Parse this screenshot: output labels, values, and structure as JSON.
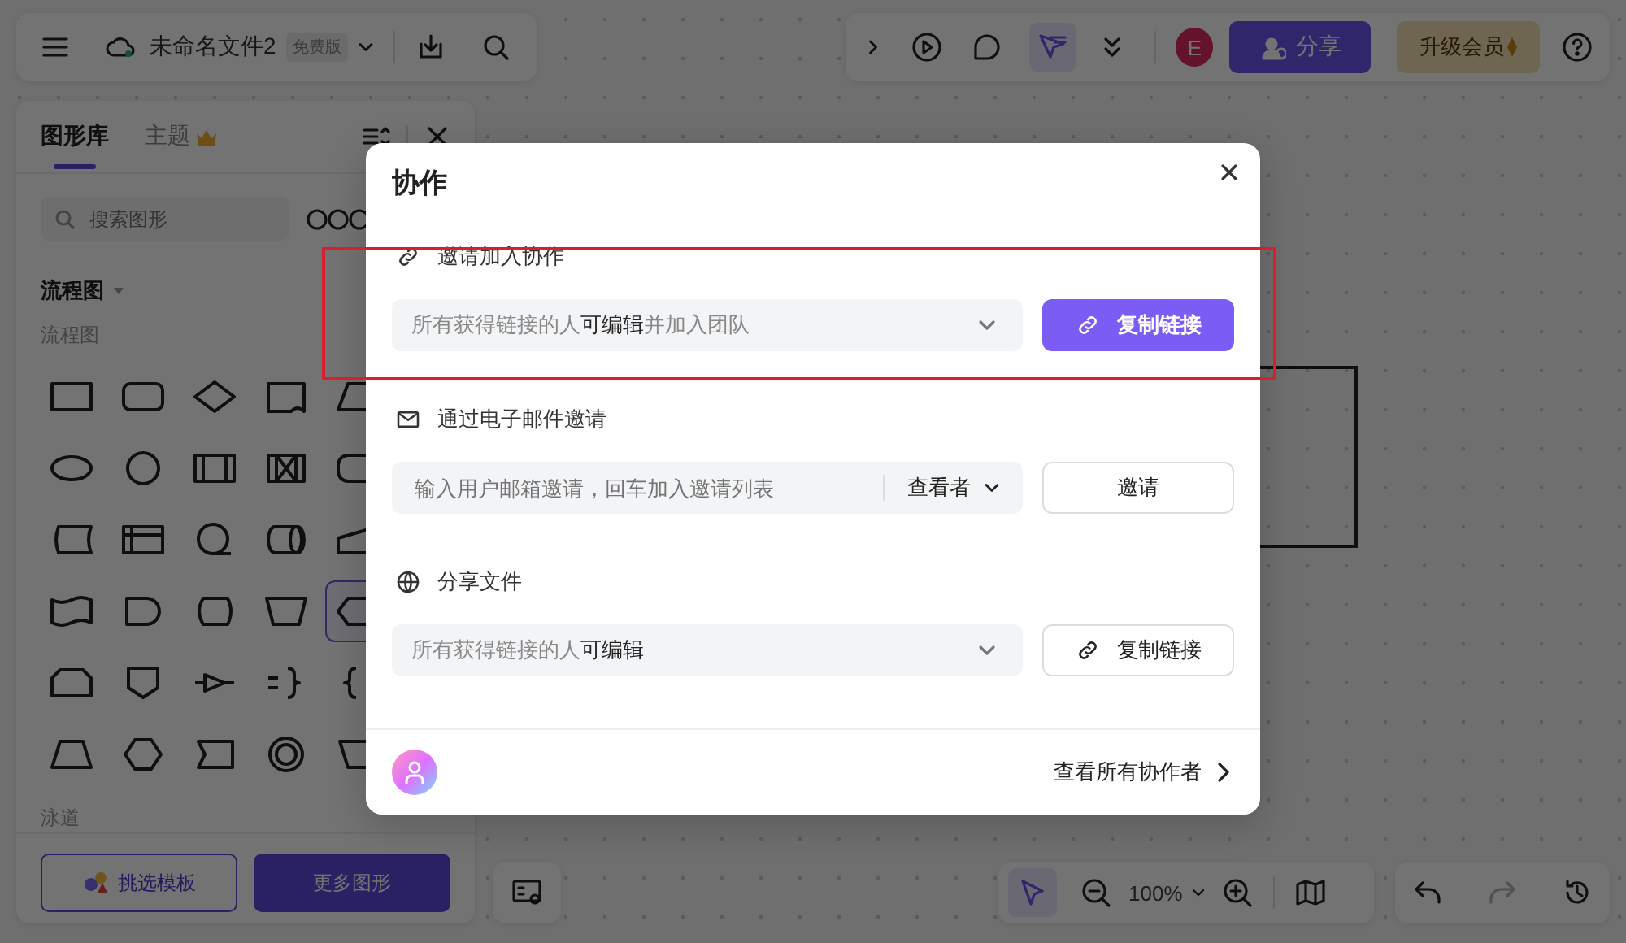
{
  "top_left_bar": {
    "file_name": "未命名文件2",
    "plan_badge": "免费版"
  },
  "top_right_bar": {
    "select_tool": {
      "selected": true
    },
    "avatar_letter": "E",
    "share_button": "分享",
    "upgrade_button": "升级会员"
  },
  "sidebar": {
    "tabs": [
      {
        "label": "图形库",
        "selected": true
      },
      {
        "label": "主题",
        "selected": false
      }
    ],
    "search": {
      "placeholder": "搜索图形"
    },
    "category": "流程图",
    "group_label": "流程图",
    "shapes": [
      {
        "kind": "rect",
        "selected": false
      },
      {
        "kind": "rounded",
        "selected": false
      },
      {
        "kind": "diamond",
        "selected": false
      },
      {
        "kind": "document",
        "selected": false
      },
      {
        "kind": "parallelogram",
        "selected": false
      },
      {
        "kind": "ellipse",
        "selected": false
      },
      {
        "kind": "circle",
        "selected": false
      },
      {
        "kind": "predefined",
        "selected": false
      },
      {
        "kind": "collate",
        "selected": false
      },
      {
        "kind": "terminal",
        "selected": false
      },
      {
        "kind": "stored",
        "selected": false
      },
      {
        "kind": "internal",
        "selected": false
      },
      {
        "kind": "sequential",
        "selected": false
      },
      {
        "kind": "cylinder",
        "selected": false
      },
      {
        "kind": "manual-input",
        "selected": false
      },
      {
        "kind": "tape",
        "selected": false
      },
      {
        "kind": "delay",
        "selected": false
      },
      {
        "kind": "display",
        "selected": false
      },
      {
        "kind": "manual-op",
        "selected": false
      },
      {
        "kind": "preparation",
        "selected": true
      },
      {
        "kind": "loop-limit",
        "selected": false
      },
      {
        "kind": "offpage",
        "selected": false
      },
      {
        "kind": "merge",
        "selected": false
      },
      {
        "kind": "brace-right",
        "selected": false
      },
      {
        "kind": "brace-left",
        "selected": false
      },
      {
        "kind": "trapezoid",
        "selected": false
      },
      {
        "kind": "hexagon",
        "selected": false
      },
      {
        "kind": "notched",
        "selected": false
      },
      {
        "kind": "double-circle",
        "selected": false
      },
      {
        "kind": "slant",
        "selected": false
      }
    ],
    "next_group_label": "泳道",
    "buttons": [
      {
        "label": "挑选模板",
        "kind": "outline"
      },
      {
        "label": "更多图形",
        "kind": "primary"
      }
    ]
  },
  "bottom_bar": {
    "pointer": {
      "selected": true
    },
    "zoom": "100%"
  },
  "dialog": {
    "title": "协作",
    "sections": [
      {
        "kind": "invite",
        "title": "邀请加入协作",
        "select": "所有获得链接的人**可编辑**并加入团队",
        "button": {
          "label": "复制链接",
          "kind": "primary"
        }
      },
      {
        "kind": "email",
        "title": "通过电子邮件邀请",
        "input": {
          "placeholder": "输入用户邮箱邀请，回车加入邀请列表",
          "role": "查看者"
        },
        "button": {
          "label": "邀请",
          "kind": "plain"
        }
      },
      {
        "kind": "share",
        "title": "分享文件",
        "select": "所有获得链接的人**可编辑**",
        "button": {
          "label": "复制链接",
          "kind": "outline"
        }
      }
    ],
    "footer_link": "查看所有协作者"
  }
}
